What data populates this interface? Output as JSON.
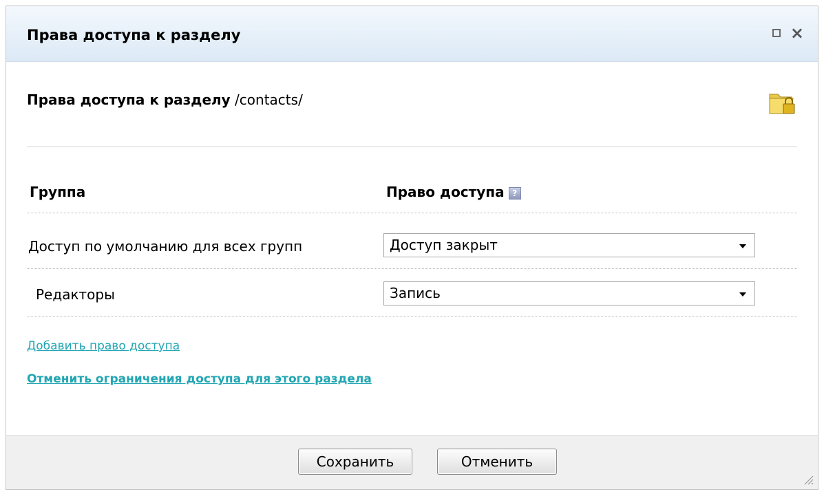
{
  "dialog": {
    "title": "Права доступа к разделу",
    "window_buttons": [
      "maximize-icon",
      "close-icon"
    ]
  },
  "content": {
    "heading_bold": "Права доступа к разделу",
    "heading_path": " /contacts/",
    "folder_icon": "folder-lock-icon"
  },
  "table": {
    "col_group": "Группа",
    "col_access": "Право доступа",
    "help_icon": "help-icon",
    "rows": [
      {
        "group": "Доступ по умолчанию для всех групп",
        "access": "Доступ закрыт"
      },
      {
        "group": "Редакторы",
        "access": "Запись"
      }
    ]
  },
  "links": {
    "add_access": "Добавить право доступа",
    "remove_restrictions": "Отменить ограничения доступа для этого раздела"
  },
  "footer": {
    "save_label": "Сохранить",
    "cancel_label": "Отменить"
  },
  "colors": {
    "title_bg_top": "#f3f8fd",
    "title_bg_bottom": "#dce9f6",
    "link": "#22a6b3",
    "footer_bg": "#f0f0f0"
  }
}
